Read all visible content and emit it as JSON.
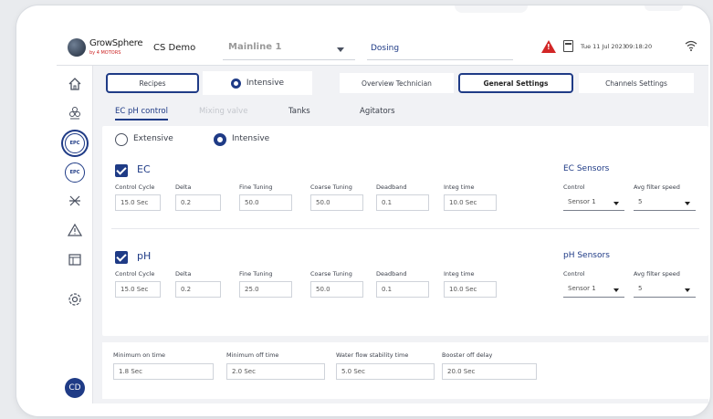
{
  "topbar": {
    "brand": "GrowSphere",
    "brand_sub": "by 4 MOTORS",
    "project": "CS Demo",
    "mainline": "Mainline 1",
    "module": "Dosing",
    "date": "Tue 11 Jul 2023",
    "time": "09:18:20"
  },
  "sidebar": {
    "items": [
      "home-icon",
      "plant-icon",
      "epc-icon",
      "epc-icon",
      "irrigation-icon",
      "alert-icon",
      "calendar-icon",
      "settings-icon"
    ],
    "epc_label": "EPC",
    "avatar": "CD"
  },
  "tabs": {
    "recipes": "Recipes",
    "intensive": "Intensive",
    "overview": "Overview Technician",
    "general": "General Settings",
    "channels": "Channels Settings"
  },
  "subtabs": {
    "ec_ph": "EC pH control",
    "mixing": "Mixing valve",
    "tanks": "Tanks",
    "agitators": "Agitators"
  },
  "mode": {
    "extensive": "Extensive",
    "intensive": "Intensive",
    "selected": "Intensive"
  },
  "ec": {
    "title": "EC",
    "labels": [
      "Control Cycle",
      "Delta",
      "Fine Tuning",
      "Coarse Tuning",
      "Deadband",
      "Integ time"
    ],
    "values": [
      "15.0 Sec",
      "0.2",
      "50.0",
      "50.0",
      "0.1",
      "10.0 Sec"
    ],
    "sensors_title": "EC Sensors",
    "control_label": "Control",
    "control_value": "Sensor 1",
    "filter_label": "Avg filter speed",
    "filter_value": "5"
  },
  "ph": {
    "title": "pH",
    "labels": [
      "Control Cycle",
      "Delta",
      "Fine Tuning",
      "Coarse Tuning",
      "Deadband",
      "Integ time"
    ],
    "values": [
      "15.0 Sec",
      "0.2",
      "25.0",
      "50.0",
      "0.1",
      "10.0 Sec"
    ],
    "sensors_title": "pH Sensors",
    "control_label": "Control",
    "control_value": "Sensor 1",
    "filter_label": "Avg filter speed",
    "filter_value": "5"
  },
  "timing": {
    "labels": [
      "Minimum on time",
      "Minimum off time",
      "Water flow stability time",
      "Booster off delay"
    ],
    "values": [
      "1.8 Sec",
      "2.0 Sec",
      "5.0 Sec",
      "20.0 Sec"
    ]
  },
  "colors": {
    "accent": "#1f3b86",
    "alert": "#d22626"
  }
}
